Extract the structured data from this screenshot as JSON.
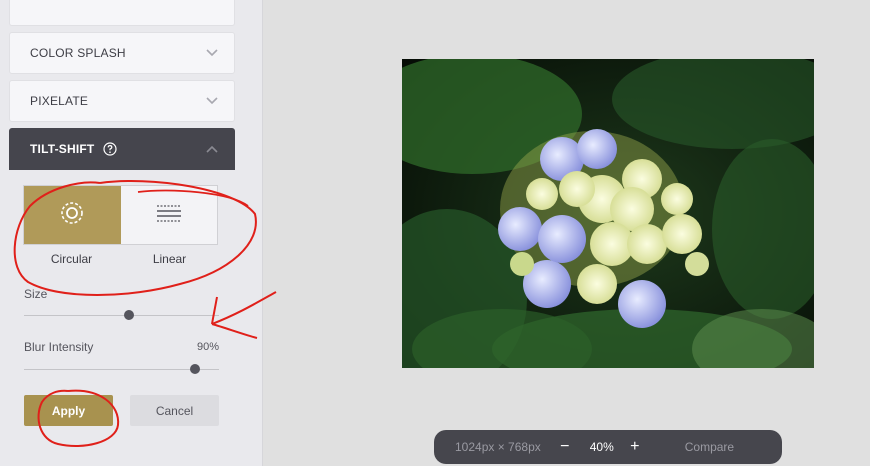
{
  "sidebar": {
    "accordions": [
      {
        "label": "COLOR SPLASH"
      },
      {
        "label": "PIXELATE"
      }
    ],
    "active_panel": {
      "label": "TILT-SHIFT"
    },
    "modes": [
      {
        "label": "Circular",
        "selected": true
      },
      {
        "label": "Linear",
        "selected": false
      }
    ],
    "size": {
      "label": "Size",
      "value_fraction": 0.54
    },
    "blur": {
      "label": "Blur Intensity",
      "value": "90%",
      "value_fraction": 0.875
    },
    "apply_label": "Apply",
    "cancel_label": "Cancel"
  },
  "toolbar": {
    "dimensions": "1024px × 768px",
    "zoom_out": "−",
    "zoom": "40%",
    "zoom_in": "+",
    "compare": "Compare"
  },
  "colors": {
    "accent": "#b09a59",
    "panel_dark": "#45454d",
    "annotation": "#e0201a"
  }
}
